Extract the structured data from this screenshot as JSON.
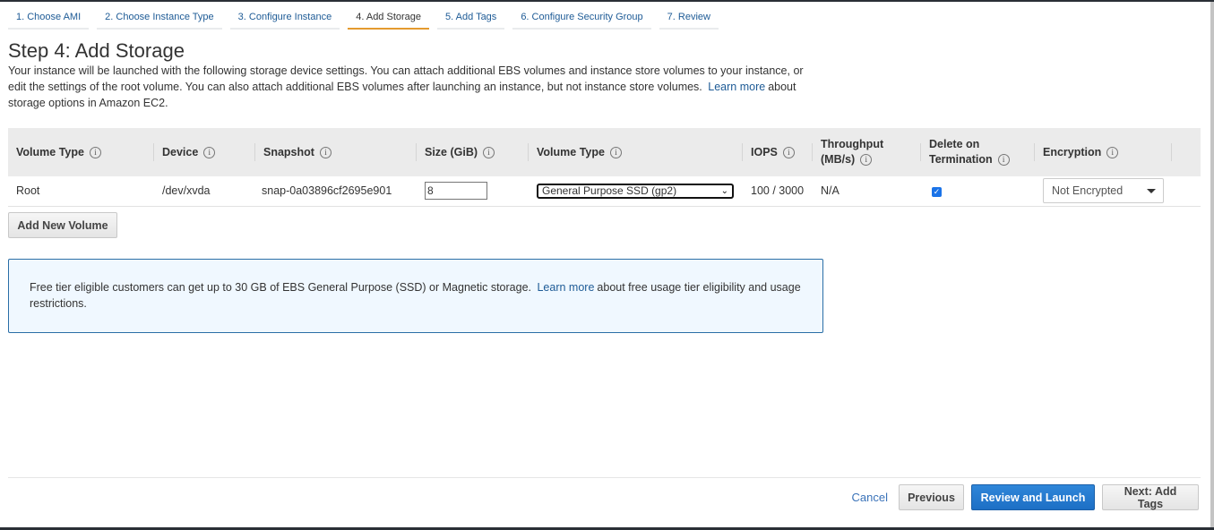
{
  "wizard": {
    "steps": [
      {
        "label": "1. Choose AMI",
        "active": false
      },
      {
        "label": "2. Choose Instance Type",
        "active": false
      },
      {
        "label": "3. Configure Instance",
        "active": false
      },
      {
        "label": "4. Add Storage",
        "active": true
      },
      {
        "label": "5. Add Tags",
        "active": false
      },
      {
        "label": "6. Configure Security Group",
        "active": false
      },
      {
        "label": "7. Review",
        "active": false
      }
    ]
  },
  "page": {
    "title": "Step 4: Add Storage",
    "description_part1": "Your instance will be launched with the following storage device settings. You can attach additional EBS volumes and instance store volumes to your instance, or edit the settings of the root volume. You can also attach additional EBS volumes after launching an instance, but not instance store volumes.",
    "description_link": "Learn more",
    "description_part2": "about storage options in Amazon EC2."
  },
  "table": {
    "headers": {
      "volume_type": "Volume Type",
      "device": "Device",
      "snapshot": "Snapshot",
      "size": "Size (GiB)",
      "volume_type2": "Volume Type",
      "iops": "IOPS",
      "throughput_l1": "Throughput",
      "throughput_l2": "(MB/s)",
      "delete_l1": "Delete on",
      "delete_l2": "Termination",
      "encryption": "Encryption"
    },
    "info_icon": "i",
    "rows": [
      {
        "volume_type": "Root",
        "device": "/dev/xvda",
        "snapshot": "snap-0a03896cf2695e901",
        "size": "8",
        "ebs_type": "General Purpose SSD (gp2)",
        "iops": "100 / 3000",
        "throughput": "N/A",
        "delete_on_termination": true,
        "encryption": "Not Encrypted"
      }
    ]
  },
  "buttons": {
    "add_volume": "Add New Volume",
    "cancel": "Cancel",
    "previous": "Previous",
    "review_launch": "Review and Launch",
    "next": "Next: Add Tags"
  },
  "notice": {
    "part1": "Free tier eligible customers can get up to 30 GB of EBS General Purpose (SSD) or Magnetic storage.",
    "link": "Learn more",
    "part2": "about free usage tier eligibility and usage restrictions."
  },
  "colors": {
    "accent_tab": "#e49a2f",
    "link": "#1e5b96",
    "primary_button": "#1d6fc5"
  }
}
